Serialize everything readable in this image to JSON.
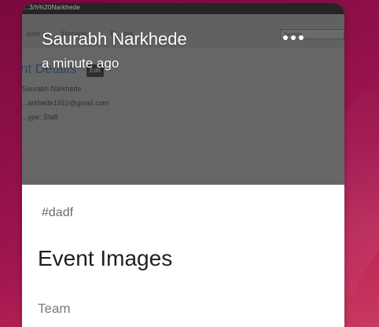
{
  "post": {
    "author": "Saurabh Narkhede",
    "time": "a minute ago",
    "more_icon": "more-horizontal-icon",
    "tag": "#dadf",
    "title": "Event Images",
    "category": "Team"
  },
  "thumbnail": {
    "topbar_text": "...3/h%20Narkhede",
    "nav_items": [
      "...eate an...",
      "Manage...",
      "R... me..."
    ],
    "search_placeholder": "Search",
    "heading": "nt Details",
    "edit_label": "Edit",
    "lines": [
      "Saurabh Narkhede",
      "...arkhede1910@gmail.com",
      "...ype: Staff"
    ]
  },
  "colors": {
    "background": "#8c0f48",
    "card": "#ffffff",
    "overlay": "#6f6f6f"
  }
}
